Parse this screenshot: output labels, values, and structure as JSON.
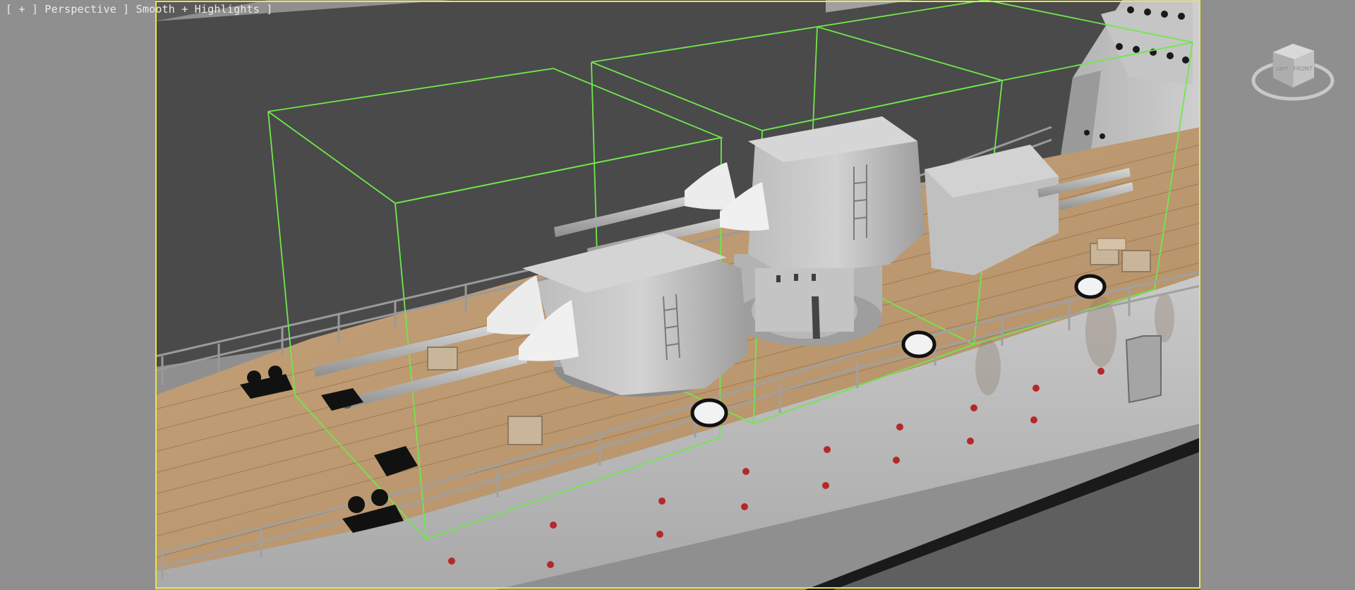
{
  "viewport": {
    "label_parts": [
      "[ + ]",
      "[ Perspective ]",
      "[ Smooth + Highlights ]"
    ],
    "label_text": "[ + ] Perspective ] Smooth + Highlights ]",
    "safe_frame_color": "#e6e64a",
    "selection_color": "#6fe84a"
  },
  "viewcube": {
    "face_label": "FRONT",
    "side_label": "LEFT",
    "icon": "viewcube-icon"
  },
  "scene": {
    "object": "naval-ship-deck-with-twin-gun-turrets",
    "selected_objects": 3
  }
}
